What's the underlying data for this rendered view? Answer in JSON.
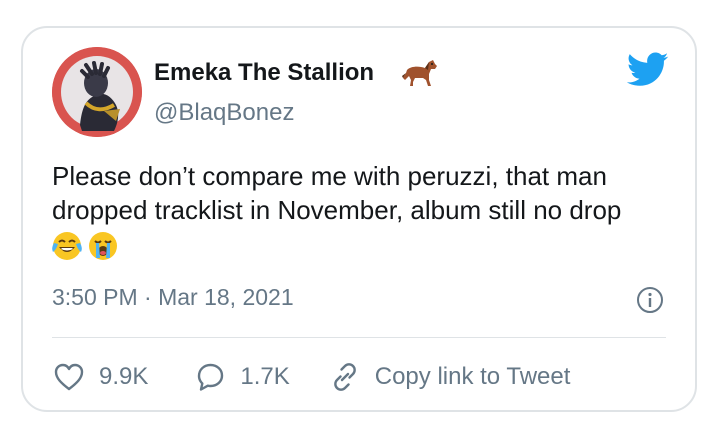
{
  "author": {
    "display_name": "Emeka The Stallion",
    "name_emoji": "horse-emoji",
    "handle": "@BlaqBonez",
    "avatar_icon": "avatar"
  },
  "tweet": {
    "text": "Please don’t compare me with peruzzi, that man dropped tracklist in November, album still no drop",
    "emojis": [
      "face-with-tears-of-joy-emoji",
      "loudly-crying-face-emoji"
    ],
    "timestamp": "3:50 PM · Mar 18, 2021"
  },
  "actions": {
    "like_count": "9.9K",
    "reply_count": "1.7K",
    "copy_link_label": "Copy link to Tweet"
  },
  "colors": {
    "twitter_blue": "#1da1f2",
    "text_primary": "#14171a",
    "text_secondary": "#657786",
    "border": "#dfe3e6"
  }
}
